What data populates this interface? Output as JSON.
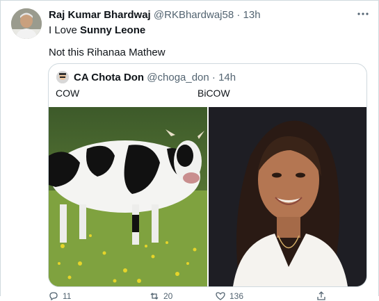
{
  "tweet": {
    "author_name": "Raj Kumar Bhardwaj",
    "handle": "@RKBhardwaj58",
    "separator": "·",
    "time": "13h",
    "text_prefix": "I Love ",
    "text_bold": "Sunny Leone",
    "text_line2": "Not this Rihanaa Mathew"
  },
  "quote": {
    "author_name": "CA Chota Don",
    "handle": "@choga_don",
    "separator": "·",
    "time": "14h",
    "label_left": "COW",
    "label_right": "BiCOW"
  },
  "actions": [
    {
      "icon": "reply-icon",
      "count": "11"
    },
    {
      "icon": "retweet-icon",
      "count": "20"
    },
    {
      "icon": "like-icon",
      "count": "136"
    },
    {
      "icon": "share-icon",
      "count": ""
    }
  ],
  "colors": {
    "text": "#0f1419",
    "muted": "#536471",
    "border": "#cfd9de"
  }
}
